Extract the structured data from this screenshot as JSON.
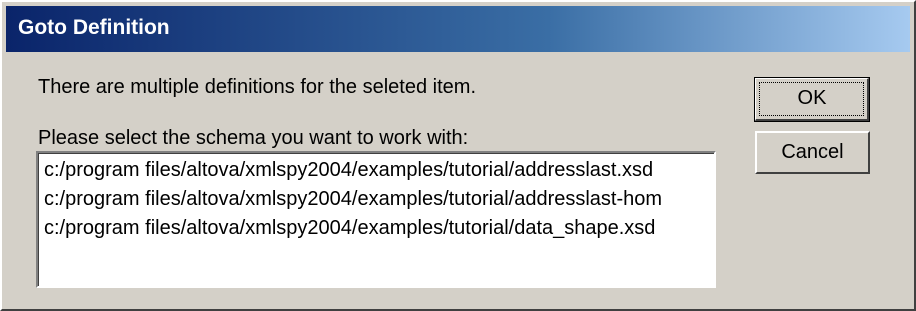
{
  "window": {
    "title": "Goto Definition"
  },
  "message": "There are multiple definitions for the seleted item.",
  "prompt": "Please select the schema you want to work with:",
  "schemas": [
    "c:/program files/altova/xmlspy2004/examples/tutorial/addresslast.xsd",
    "c:/program files/altova/xmlspy2004/examples/tutorial/addresslast-hom",
    "c:/program files/altova/xmlspy2004/examples/tutorial/data_shape.xsd"
  ],
  "buttons": {
    "ok_label": "OK",
    "cancel_label": "Cancel"
  },
  "colors": {
    "dialog_face": "#d4d0c8",
    "title_start": "#0a246a",
    "title_end": "#a6caf0"
  }
}
